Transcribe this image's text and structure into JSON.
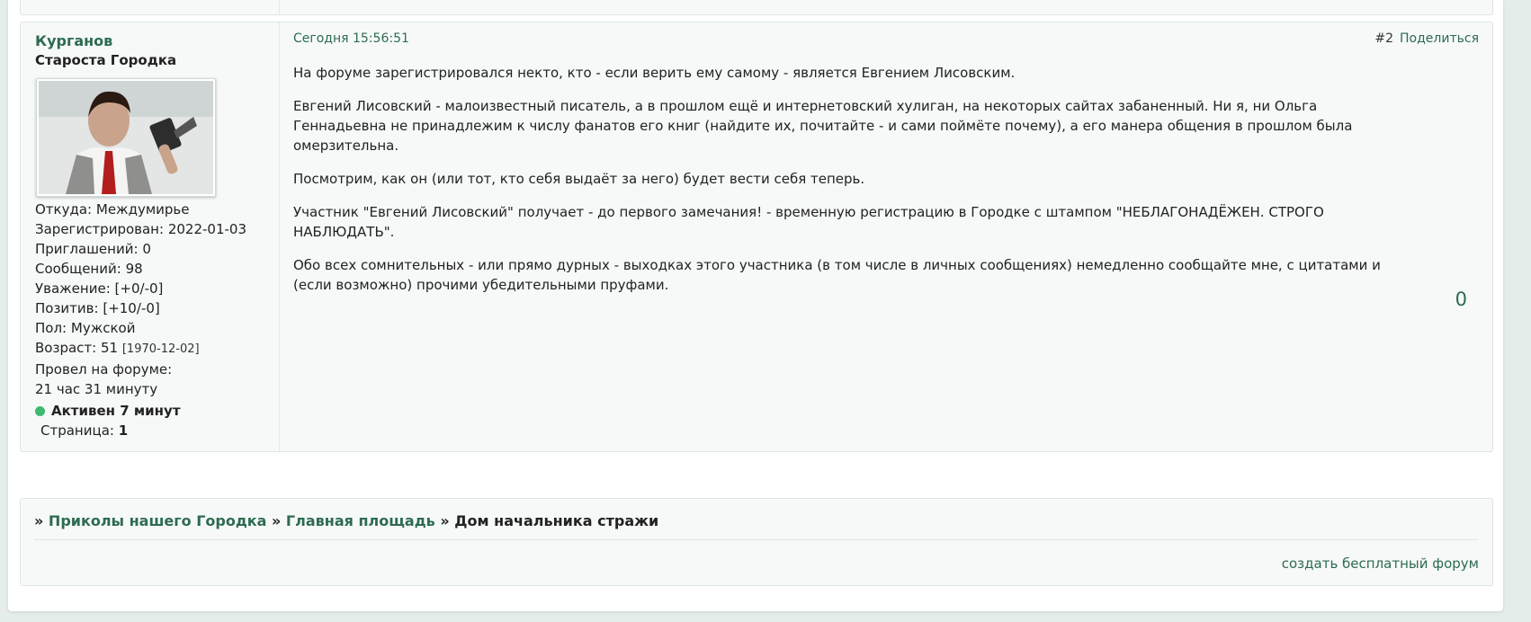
{
  "post": {
    "author": {
      "name": "Курганов",
      "title": "Староста Городка",
      "avatar_icon": "avatar-photo",
      "info": [
        {
          "label": "Откуда:",
          "value": "Междумирье"
        },
        {
          "label": "Зарегистрирован:",
          "value": "2022-01-03"
        },
        {
          "label": "Приглашений:",
          "value": "0"
        },
        {
          "label": "Сообщений:",
          "value": "98"
        },
        {
          "label": "Уважение:",
          "value": "[+0/-0]"
        },
        {
          "label": "Позитив:",
          "value": "[+10/-0]"
        },
        {
          "label": "Пол:",
          "value": "Мужской"
        },
        {
          "label": "Возраст:",
          "value": "51",
          "extra": "[1970-12-02]"
        },
        {
          "label": "Провел на форуме:",
          "value": ""
        }
      ],
      "time_on_forum": "21 час 31 минуту",
      "online_status": "Активен 7 минут",
      "online_color": "#3cba6e"
    },
    "date": "Сегодня 15:56:51",
    "number": "#2",
    "share_label": "Поделиться",
    "paragraphs": [
      "На форуме зарегистрировался некто, кто - если верить ему самому - является Евгением Лисовским.",
      "Евгений Лисовский - малоизвестный писатель, а в прошлом ещё и интернетовский хулиган, на некоторых сайтах забаненный. Ни я, ни Ольга Геннадьевна не принадлежим к числу фанатов его книг (найдите их, почитайте - и сами поймёте почему), а его манера общения в прошлом была омерзительна.",
      "Посмотрим, как он (или тот, кто себя выдаёт за него) будет вести себя теперь.",
      "Участник \"Евгений Лисовский\" получает - до первого замечания! - временную регистрацию в Городке с штампом \"НЕБЛАГОНАДЁЖЕН. СТРОГО НАБЛЮДАТЬ\".",
      "Обо всех сомнительных - или прямо дурных - выходках этого участника (в том числе в личных сообщениях) немедленно сообщайте мне, с цитатами и (если возможно) прочими убедительными пруфами."
    ],
    "rating": "0"
  },
  "pagination": {
    "label": "Страница:",
    "current": "1"
  },
  "breadcrumb": {
    "separator": "»",
    "items": [
      {
        "label": "Приколы нашего Городка",
        "link": true
      },
      {
        "label": "Главная площадь",
        "link": true
      },
      {
        "label": "Дом начальника стражи",
        "link": false
      }
    ]
  },
  "footer": {
    "link_label": "создать бесплатный форум"
  },
  "colors": {
    "accent": "#2e6b50",
    "background": "#e4ede9",
    "panel": "#f6f9f8",
    "border": "#dde6e2"
  }
}
